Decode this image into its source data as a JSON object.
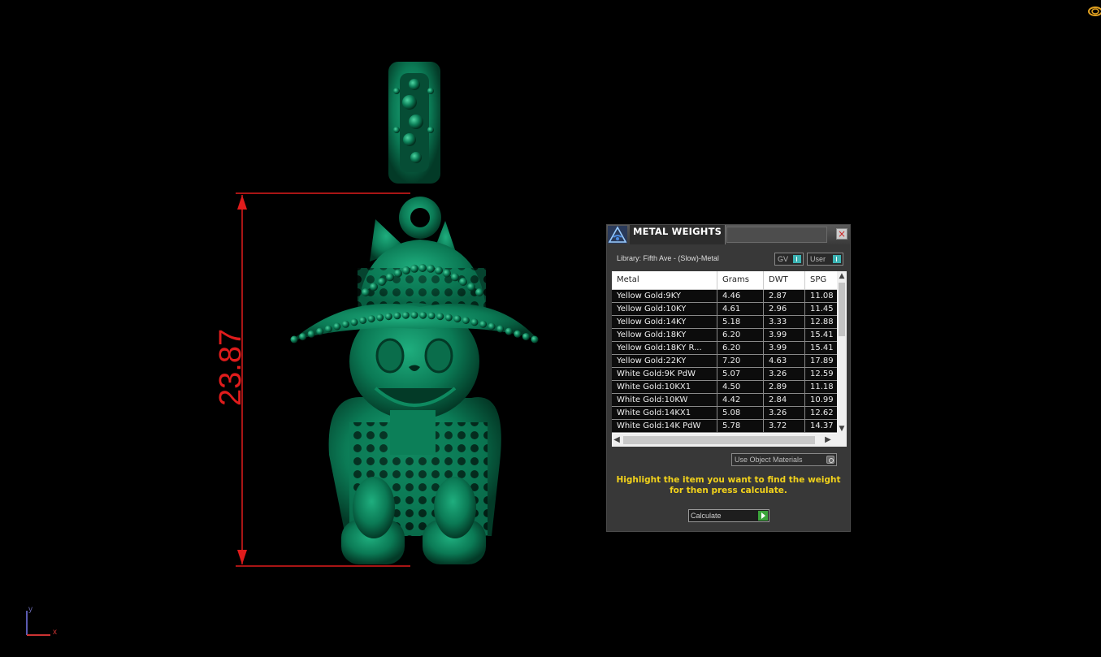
{
  "viewport": {
    "dimension_value": "23.87",
    "axis_x": "x",
    "axis_y": "y",
    "dimension_color": "#e01c1c",
    "model_color": "#0b7a55"
  },
  "metal_weights_panel": {
    "title": "METAL WEIGHTS",
    "close_icon": "×",
    "library_label": "Library: Fifth Ave - (Slow)-Metal",
    "toggle_gv": "GV",
    "toggle_user": "User",
    "columns": [
      "Metal",
      "Grams",
      "DWT",
      "SPG"
    ],
    "rows": [
      {
        "metal": "Yellow Gold:9KY",
        "grams": "4.46",
        "dwt": "2.87",
        "spg": "11.08"
      },
      {
        "metal": "Yellow Gold:10KY",
        "grams": "4.61",
        "dwt": "2.96",
        "spg": "11.45"
      },
      {
        "metal": "Yellow Gold:14KY",
        "grams": "5.18",
        "dwt": "3.33",
        "spg": "12.88"
      },
      {
        "metal": "Yellow Gold:18KY",
        "grams": "6.20",
        "dwt": "3.99",
        "spg": "15.41"
      },
      {
        "metal": "Yellow Gold:18KY R...",
        "grams": "6.20",
        "dwt": "3.99",
        "spg": "15.41"
      },
      {
        "metal": "Yellow Gold:22KY",
        "grams": "7.20",
        "dwt": "4.63",
        "spg": "17.89"
      },
      {
        "metal": "White Gold:9K PdW",
        "grams": "5.07",
        "dwt": "3.26",
        "spg": "12.59"
      },
      {
        "metal": "White Gold:10KX1",
        "grams": "4.50",
        "dwt": "2.89",
        "spg": "11.18"
      },
      {
        "metal": "White Gold:10KW",
        "grams": "4.42",
        "dwt": "2.84",
        "spg": "10.99"
      },
      {
        "metal": "White Gold:14KX1",
        "grams": "5.08",
        "dwt": "3.26",
        "spg": "12.62"
      },
      {
        "metal": "White Gold:14K PdW",
        "grams": "5.78",
        "dwt": "3.72",
        "spg": "14.37"
      }
    ],
    "use_object_materials": "Use Object Materials",
    "instruction_line1": "Highlight the item you want to find the weight",
    "instruction_line2": "for then press calculate.",
    "calculate_label": "Calculate",
    "instruction_color": "#f2d21b",
    "toggle_accent": "#3bb3b3",
    "calculate_accent": "#3aa43a"
  }
}
